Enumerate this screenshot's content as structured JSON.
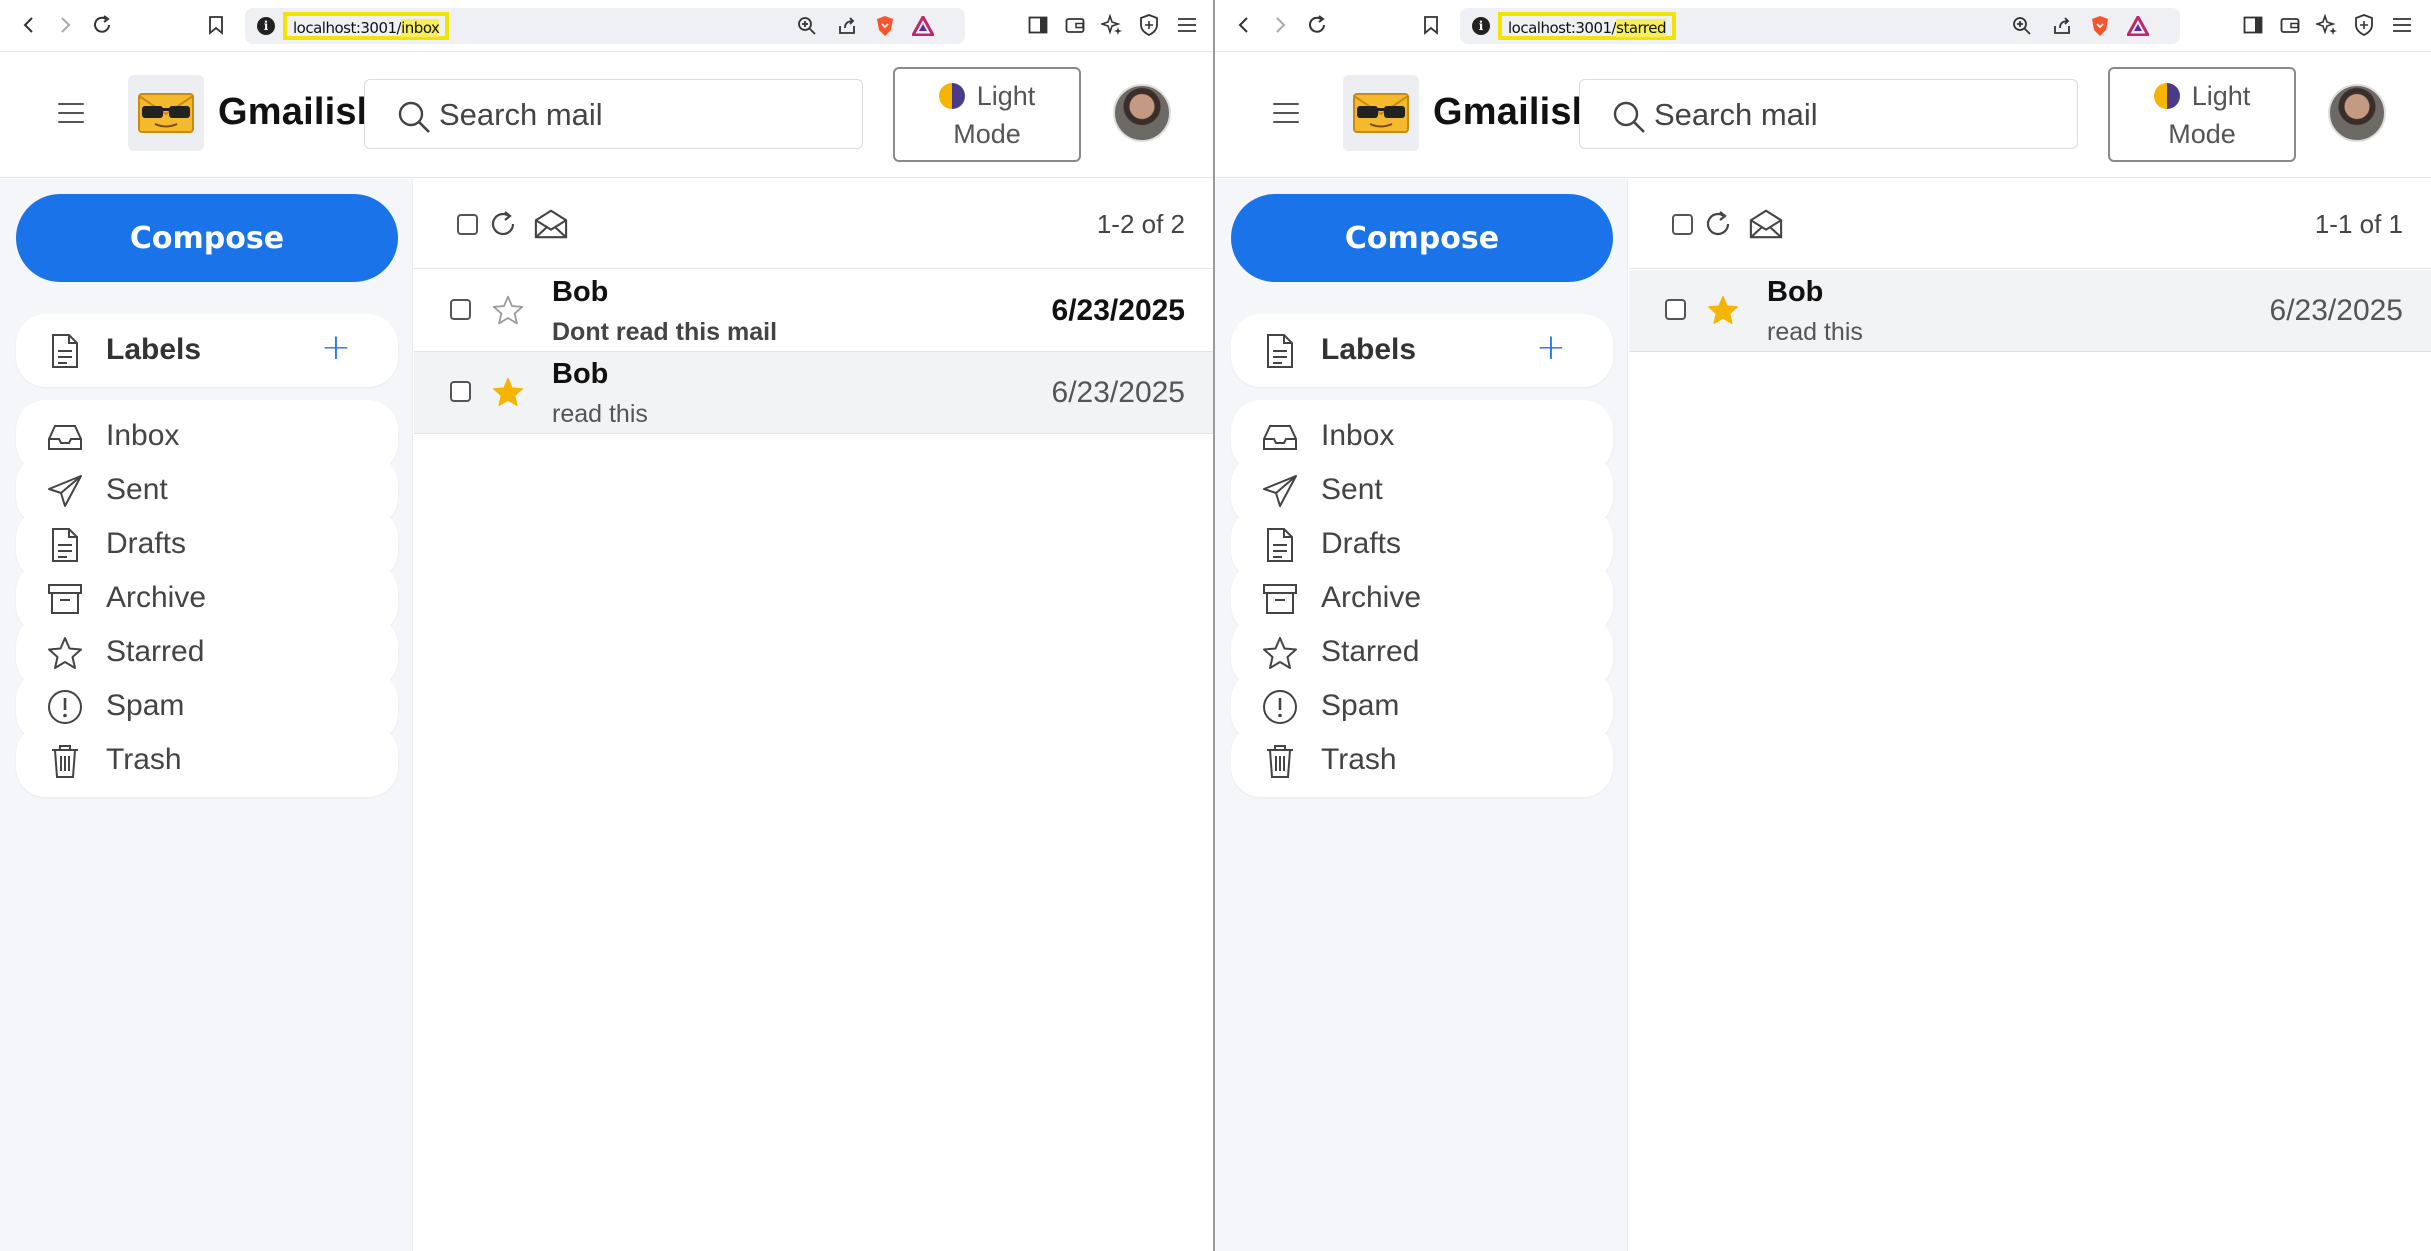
{
  "colors": {
    "accent": "#1a73e8",
    "star": "#f4b400",
    "highlight": "#f2e400"
  },
  "panes": [
    {
      "url_host": "localhost:3001/",
      "url_path": "inbox",
      "brand": "Gmailish",
      "search_placeholder": "Search mail",
      "mode_line1": "Light",
      "mode_line2": "Mode",
      "compose": "Compose",
      "labels": "Labels",
      "nav": [
        "Inbox",
        "Sent",
        "Drafts",
        "Archive",
        "Starred",
        "Spam",
        "Trash"
      ],
      "count": "1-2 of 2",
      "emails": [
        {
          "sender": "Bob",
          "subject": "Dont read this mail",
          "date": "6/23/2025",
          "starred": false,
          "unread": true
        },
        {
          "sender": "Bob",
          "subject": "read this",
          "date": "6/23/2025",
          "starred": true,
          "unread": false
        }
      ]
    },
    {
      "url_host": "localhost:3001/",
      "url_path": "starred",
      "brand": "Gmailish",
      "search_placeholder": "Search mail",
      "mode_line1": "Light",
      "mode_line2": "Mode",
      "compose": "Compose",
      "labels": "Labels",
      "nav": [
        "Inbox",
        "Sent",
        "Drafts",
        "Archive",
        "Starred",
        "Spam",
        "Trash"
      ],
      "count": "1-1 of 1",
      "emails": [
        {
          "sender": "Bob",
          "subject": "read this",
          "date": "6/23/2025",
          "starred": true,
          "unread": false
        }
      ]
    }
  ]
}
